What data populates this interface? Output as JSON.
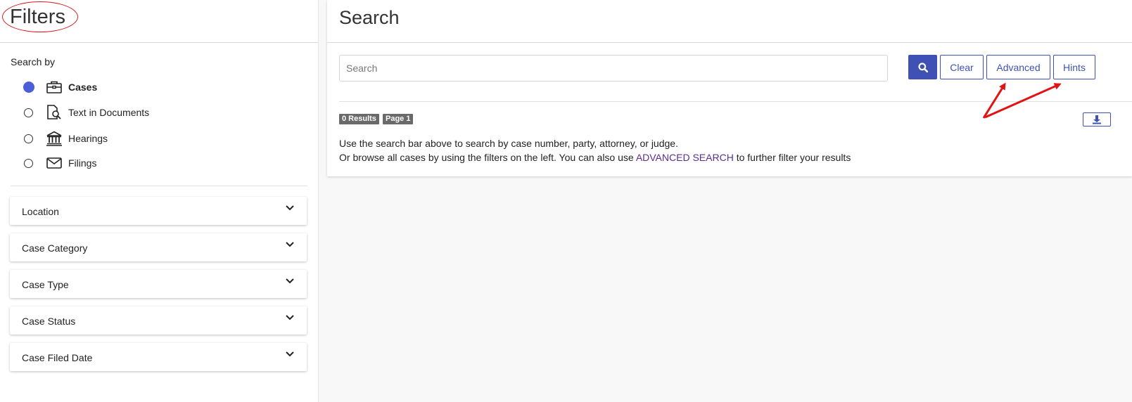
{
  "sidebar": {
    "title": "Filters",
    "search_by_label": "Search by",
    "search_options": [
      {
        "label": "Cases",
        "icon": "briefcase-icon",
        "checked": true
      },
      {
        "label": "Text in Documents",
        "icon": "document-search-icon",
        "checked": false
      },
      {
        "label": "Hearings",
        "icon": "courthouse-icon",
        "checked": false
      },
      {
        "label": "Filings",
        "icon": "envelope-icon",
        "checked": false
      }
    ],
    "filter_panels": [
      {
        "label": "Location"
      },
      {
        "label": "Case Category"
      },
      {
        "label": "Case Type"
      },
      {
        "label": "Case Status"
      },
      {
        "label": "Case Filed Date"
      }
    ]
  },
  "main": {
    "title": "Search",
    "search": {
      "placeholder": "Search",
      "value": ""
    },
    "buttons": {
      "clear": "Clear",
      "advanced": "Advanced",
      "hints": "Hints"
    },
    "results_badge": "0 Results",
    "page_badge": "Page 1",
    "info": {
      "line1": "Use the search bar above to search by case number, party, attorney, or judge.",
      "line2_before": "Or browse all cases by using the filters on the left. You can also use ",
      "line2_link": "ADVANCED SEARCH",
      "line2_after": " to further filter your results"
    }
  },
  "colors": {
    "accent": "#3f51b5",
    "radio_checked": "#4a5fd8",
    "annotation": "#e01414",
    "link": "#5b2d91"
  }
}
